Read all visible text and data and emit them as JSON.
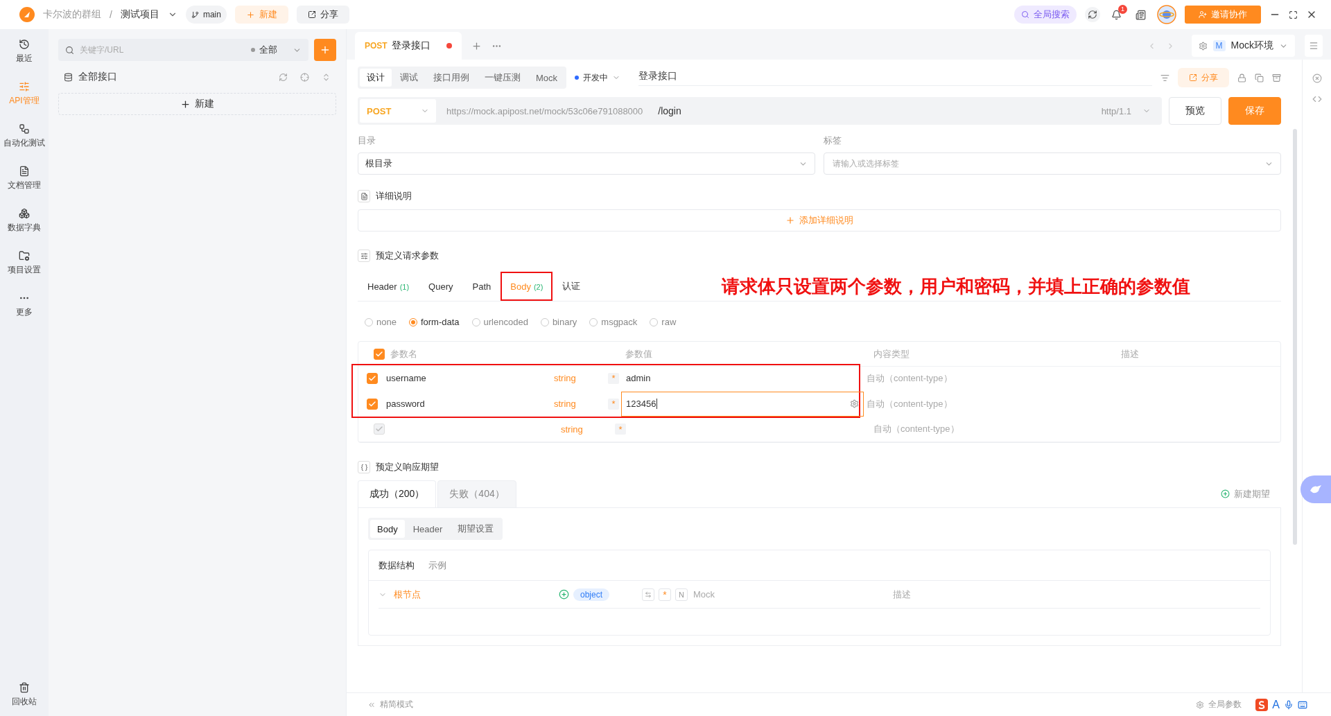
{
  "top_bar": {
    "team": "卡尔波的群组",
    "separator": "/",
    "project": "测试项目",
    "branch": "main",
    "new_button": "新建",
    "share_button": "分享",
    "search_button": "全局搜索",
    "notification_count": "1",
    "invite_button": "邀请协作"
  },
  "nav_rail": {
    "items": [
      {
        "label": "最近",
        "selected": false
      },
      {
        "label": "API管理",
        "selected": true
      },
      {
        "label": "自动化测试",
        "selected": false
      },
      {
        "label": "文档管理",
        "selected": false
      },
      {
        "label": "数据字典",
        "selected": false
      },
      {
        "label": "项目设置",
        "selected": false
      },
      {
        "label": "更多",
        "selected": false
      }
    ],
    "trash": "回收站"
  },
  "tree_panel": {
    "search_placeholder": "关键字/URL",
    "filter": "全部",
    "root": "全部接口",
    "new_button": "新建"
  },
  "tabs": [
    {
      "method": "POST",
      "title": "登录接口",
      "unsaved": true,
      "selected": true
    }
  ],
  "environment": {
    "badge": "M",
    "name": "Mock环境"
  },
  "mode_tabs": [
    {
      "label": "设计",
      "selected": true
    },
    {
      "label": "调试",
      "selected": false
    },
    {
      "label": "接口用例",
      "selected": false
    },
    {
      "label": "一键压测",
      "selected": false
    },
    {
      "label": "Mock",
      "selected": false
    }
  ],
  "status": "开发中",
  "api_name": "登录接口",
  "share_button": "分享",
  "request": {
    "method": "POST",
    "base_url": "https://mock.apipost.net/mock/53c06e791088000",
    "path": "/login",
    "protocol": "http/1.1",
    "preview_button": "预览",
    "save_button": "保存"
  },
  "directory": {
    "label": "目录",
    "value": "根目录"
  },
  "tags": {
    "label": "标签",
    "placeholder": "请输入或选择标签"
  },
  "description": {
    "title": "详细说明",
    "add_button": "添加详细说明"
  },
  "params": {
    "title": "预定义请求参数",
    "annotation": "请求体只设置两个参数，用户和密码，并填上正确的参数值",
    "tabs": [
      {
        "label": "Header",
        "count": "(1)",
        "selected": false,
        "annotated": false
      },
      {
        "label": "Query",
        "selected": false,
        "annotated": false
      },
      {
        "label": "Path",
        "selected": false,
        "annotated": false
      },
      {
        "label": "Body",
        "count": "(2)",
        "selected": true,
        "annotated": true
      },
      {
        "label": "认证",
        "selected": false,
        "annotated": false
      }
    ],
    "body_types": [
      {
        "label": "none",
        "selected": false
      },
      {
        "label": "form-data",
        "selected": true
      },
      {
        "label": "urlencoded",
        "selected": false
      },
      {
        "label": "binary",
        "selected": false
      },
      {
        "label": "msgpack",
        "selected": false
      },
      {
        "label": "raw",
        "selected": false
      }
    ],
    "columns": [
      "参数名",
      "参数值",
      "内容类型",
      "描述"
    ],
    "all_checked": true,
    "rows": [
      {
        "kind": "param",
        "checked": true,
        "name": "username",
        "type": "string",
        "required": "*",
        "value": "admin",
        "focused": false,
        "content_type": "自动（content-type）",
        "annotated": true
      },
      {
        "kind": "param",
        "checked": true,
        "name": "password",
        "type": "string",
        "required": "*",
        "value": "123456",
        "focused": true,
        "content_type": "自动（content-type）",
        "annotated": true
      },
      {
        "kind": "blank",
        "checked": true,
        "type": "string",
        "required": "*",
        "content_type": "自动（content-type）",
        "annotated": false
      }
    ]
  },
  "response": {
    "title": "预定义响应期望",
    "tabs": [
      {
        "label": "成功（200）",
        "selected": true
      },
      {
        "label": "失败（404）",
        "selected": false
      }
    ],
    "new_button": "新建期望",
    "sub_tabs": [
      {
        "label": "Body",
        "selected": true
      },
      {
        "label": "Header",
        "selected": false
      },
      {
        "label": "期望设置",
        "selected": false
      }
    ],
    "view_tabs": [
      {
        "label": "数据结构",
        "selected": true
      },
      {
        "label": "示例",
        "selected": false
      }
    ],
    "root": {
      "name": "根节点",
      "type": "object",
      "required_mark": "*",
      "null_mark": "N",
      "mock_placeholder": "Mock",
      "description_placeholder": "描述"
    }
  },
  "footer": {
    "simple_mode": "精简模式",
    "global_params": "全局参数"
  },
  "ime_toolbar": {
    "letter": "A"
  }
}
